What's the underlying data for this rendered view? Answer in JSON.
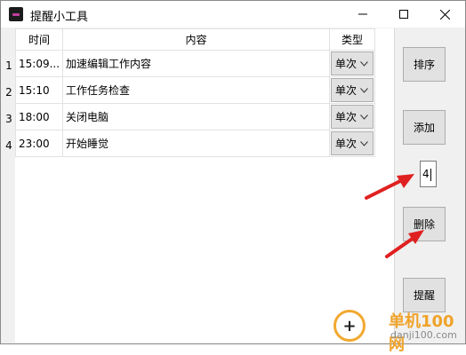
{
  "window": {
    "title": "提醒小工具"
  },
  "grid": {
    "headers": [
      "时间",
      "内容",
      "类型"
    ],
    "rows": [
      {
        "num": "1",
        "time": "15:09...",
        "content": "加速编辑工作内容",
        "type": "单次"
      },
      {
        "num": "2",
        "time": "15:10",
        "content": "工作任务检查",
        "type": "单次"
      },
      {
        "num": "3",
        "time": "18:00",
        "content": "关闭电脑",
        "type": "单次"
      },
      {
        "num": "4",
        "time": "23:00",
        "content": "开始睡觉",
        "type": "单次"
      }
    ]
  },
  "buttons": {
    "sort": "排序",
    "add": "添加",
    "delete": "删除",
    "remind": "提醒"
  },
  "index_input": {
    "value": "4"
  },
  "watermark": {
    "text": "单机100网",
    "url": "danji100.com"
  },
  "colors": {
    "arrow": "#e02020",
    "accent": "#f0a32a"
  }
}
